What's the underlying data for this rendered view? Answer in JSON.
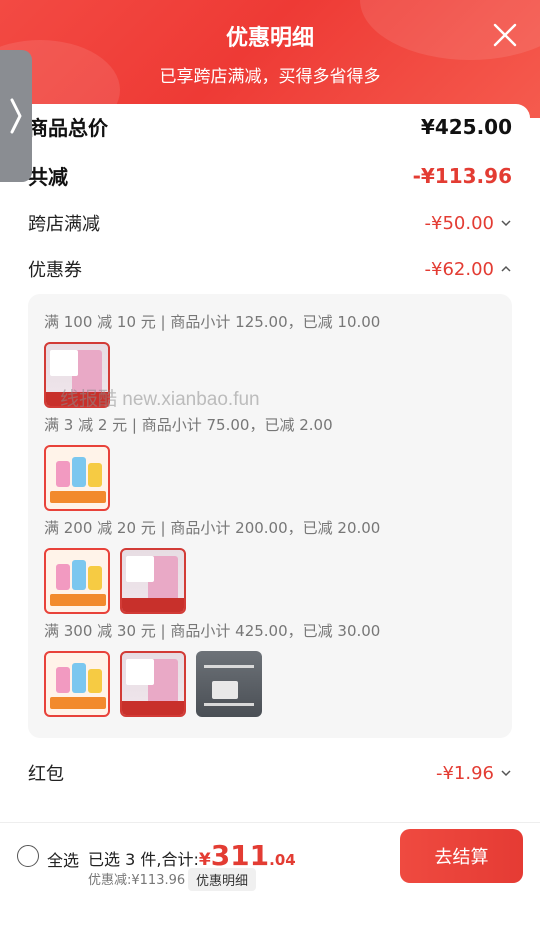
{
  "header": {
    "title": "优惠明细",
    "subtitle": "已享跨店满减，买得多省得多"
  },
  "breakdown": {
    "total_label": "商品总价",
    "total_value": "¥425.00",
    "saved_label": "共减",
    "saved_value": "-¥113.96",
    "cross_store_label": "跨店满减",
    "cross_store_value": "-¥50.00",
    "coupon_label": "优惠券",
    "coupon_value": "-¥62.00",
    "redpacket_label": "红包",
    "redpacket_value": "-¥1.96"
  },
  "coupon_rules": [
    {
      "text": "满 100 减 10 元 | 商品小计 125.00，已减 10.00",
      "thumbs": [
        "pink"
      ]
    },
    {
      "text": "满 3 减 2 元 | 商品小计 75.00，已减 2.00",
      "thumbs": [
        "colorful"
      ]
    },
    {
      "text": "满 200 减 20 元 | 商品小计 200.00，已减 20.00",
      "thumbs": [
        "colorful",
        "pink"
      ]
    },
    {
      "text": "满 300 减 30 元 | 商品小计 425.00，已减 30.00",
      "thumbs": [
        "colorful",
        "pink",
        "rack"
      ]
    }
  ],
  "watermark": "线报酷 new.xianbao.fun",
  "bottom": {
    "select_all": "全选",
    "summary_prefix": "已选 3 件,合计:",
    "price_symbol": "¥",
    "price_int": "311",
    "price_dec": ".04",
    "discount": "优惠减:¥113.96",
    "detail_chip": "优惠明细",
    "checkout": "去结算"
  },
  "colors": {
    "accent": "#e33c33",
    "header": "#ee3a35"
  }
}
